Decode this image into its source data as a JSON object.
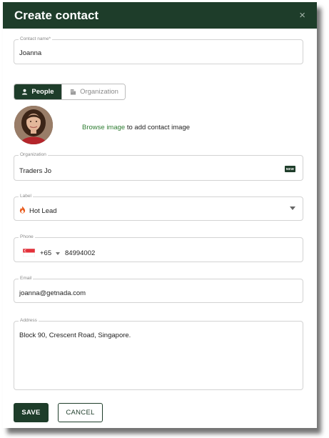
{
  "dialog": {
    "title": "Create contact",
    "close_glyph": "×"
  },
  "contact_name": {
    "label": "Contact name*",
    "value": "Joanna"
  },
  "type_toggle": {
    "options": [
      {
        "label": "People",
        "icon": "person-icon",
        "active": true
      },
      {
        "label": "Organization",
        "icon": "building-icon",
        "active": false
      }
    ]
  },
  "image": {
    "browse_link": "Browse image",
    "browse_rest": " to add contact image"
  },
  "organization": {
    "label": "Organization",
    "value": "Traders Jo",
    "badge": "NEW"
  },
  "label_field": {
    "label": "Label",
    "value": "Hot Lead",
    "icon": "flame-icon"
  },
  "phone": {
    "label": "Phone",
    "country_code": "+65",
    "number": "84994002",
    "flag": "singapore-flag-icon"
  },
  "email": {
    "label": "Email",
    "value": "joanna@getnada.com"
  },
  "address": {
    "label": "Address",
    "value": "Block 90, Crescent Road, Singapore."
  },
  "footer": {
    "save_label": "SAVE",
    "cancel_label": "CANCEL"
  },
  "colors": {
    "brand": "#1e3d2a",
    "link": "#2e7d32",
    "flame": "#e8591a",
    "flag_red": "#e4313a"
  }
}
